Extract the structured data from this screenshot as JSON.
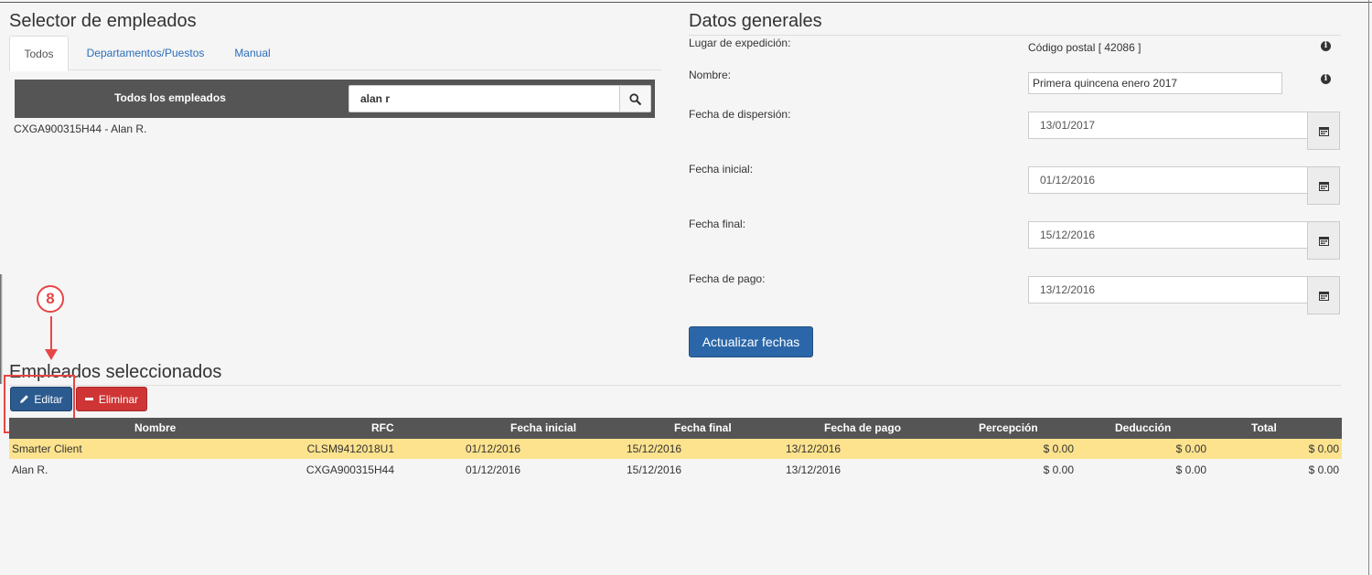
{
  "employee_selector": {
    "title": "Selector de empleados",
    "tabs": [
      {
        "label": "Todos",
        "active": true
      },
      {
        "label": "Departamentos/Puestos",
        "active": false
      },
      {
        "label": "Manual",
        "active": false
      }
    ],
    "list_title": "Todos los empleados",
    "search_value": "alan r",
    "results": [
      "CXGA900315H44 - Alan R."
    ]
  },
  "general_data": {
    "title": "Datos generales",
    "expedition_label": "Lugar de expedición:",
    "expedition_value": "Código postal [ 42086 ]",
    "name_label": "Nombre:",
    "name_value": "Primera quincena enero 2017",
    "dispersion_label": "Fecha de dispersión:",
    "dispersion_value": "13/01/2017",
    "start_label": "Fecha inicial:",
    "start_value": "01/12/2016",
    "end_label": "Fecha final:",
    "end_value": "15/12/2016",
    "payment_label": "Fecha de pago:",
    "payment_value": "13/12/2016",
    "update_button": "Actualizar fechas"
  },
  "selected_employees": {
    "title": "Empleados seleccionados",
    "edit_button": "Editar",
    "delete_button": "Eliminar",
    "columns": [
      "Nombre",
      "RFC",
      "Fecha inicial",
      "Fecha final",
      "Fecha de pago",
      "Percepción",
      "Deducción",
      "Total"
    ],
    "rows": [
      {
        "name": "Smarter Client",
        "rfc": "CLSM9412018U1",
        "start": "01/12/2016",
        "end": "15/12/2016",
        "payment": "13/12/2016",
        "perception": "$ 0.00",
        "deduction": "$ 0.00",
        "total": "$ 0.00",
        "selected": true
      },
      {
        "name": "Alan R.",
        "rfc": "CXGA900315H44",
        "start": "01/12/2016",
        "end": "15/12/2016",
        "payment": "13/12/2016",
        "perception": "$ 0.00",
        "deduction": "$ 0.00",
        "total": "$ 0.00",
        "selected": false
      }
    ]
  },
  "annotation": {
    "step_number": "8",
    "color": "#e84646"
  },
  "colors": {
    "primary": "#2b67a8",
    "danger": "#cf3535",
    "header_bg": "#555555",
    "selected_row": "#fde38e"
  },
  "icons": {
    "search": "search-icon",
    "calendar": "calendar-icon",
    "info": "info-icon",
    "pencil": "pencil-icon",
    "minus": "minus-icon"
  }
}
